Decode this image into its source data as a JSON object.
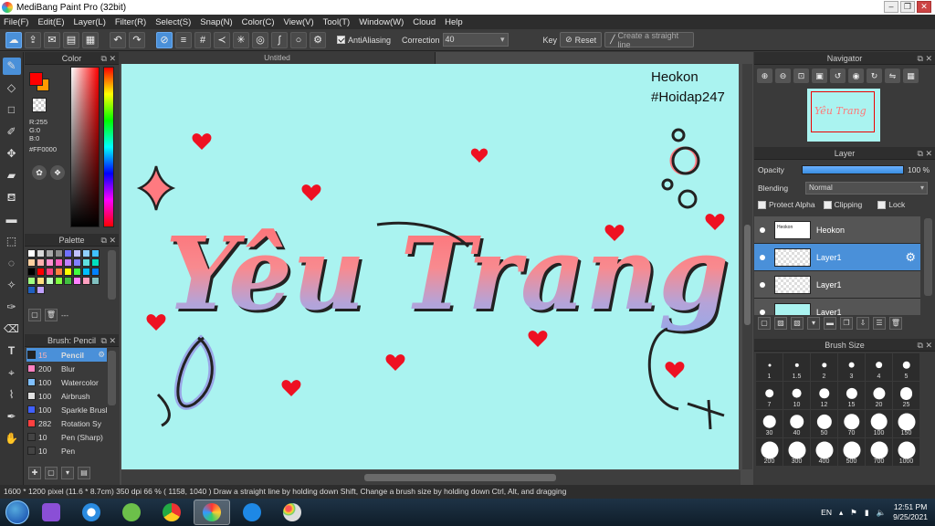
{
  "window": {
    "title": "MediBang Paint Pro (32bit)"
  },
  "menu": [
    "File(F)",
    "Edit(E)",
    "Layer(L)",
    "Filter(R)",
    "Select(S)",
    "Snap(N)",
    "Color(C)",
    "View(V)",
    "Tool(T)",
    "Window(W)",
    "Cloud",
    "Help"
  ],
  "toolbar": {
    "antialiasing_label": "AntiAliasing",
    "correction_label": "Correction",
    "correction_value": "40",
    "key_label": "Key",
    "reset_label": "Reset",
    "straight_line_placeholder": "Create a straight line"
  },
  "color_panel": {
    "title": "Color",
    "r": "R:255",
    "g": "G:0",
    "b": "B:0",
    "hex": "#FF0000",
    "fg_color": "#ff0000",
    "bg_color": "#ff9900"
  },
  "palette_panel": {
    "title": "Palette",
    "label": "---",
    "swatches": [
      "#ffffff",
      "#d8d8d8",
      "#a8a8a8",
      "#8c8c8c",
      "#7070ff",
      "#c0c0ff",
      "#90d0ff",
      "#40c0ff",
      "#ffd0a0",
      "#ffb0b0",
      "#ff90d0",
      "#ff60c0",
      "#c080ff",
      "#8080ff",
      "#60e0e0",
      "#00e0c0",
      "#000000",
      "#ff0000",
      "#ff4080",
      "#ff8040",
      "#ffff00",
      "#40ff40",
      "#00c0ff",
      "#0080ff",
      "#a0ff80",
      "#ffe080",
      "#c0ffc0",
      "#80ff40",
      "#40c040",
      "#ff80ff",
      "#ffa0c0",
      "#80c0c0",
      "#2060c0",
      "#c0a0ff"
    ]
  },
  "brush_panel": {
    "title": "Brush: Pencil",
    "brushes": [
      {
        "size": "15",
        "name": "Pencil",
        "color": "#222222",
        "selected": true
      },
      {
        "size": "200",
        "name": "Blur",
        "color": "#ff80c0",
        "selected": false
      },
      {
        "size": "100",
        "name": "Watercolor",
        "color": "#80c0ff",
        "selected": false
      },
      {
        "size": "100",
        "name": "Airbrush",
        "color": "#e0e0e0",
        "selected": false
      },
      {
        "size": "100",
        "name": "Sparkle Brush",
        "color": "#4060ff",
        "selected": false
      },
      {
        "size": "282",
        "name": "Rotation Sy",
        "color": "#ff4040",
        "selected": false
      },
      {
        "size": "10",
        "name": "Pen (Sharp)",
        "color": "#444444",
        "selected": false
      },
      {
        "size": "10",
        "name": "Pen",
        "color": "#444444",
        "selected": false
      }
    ]
  },
  "canvas": {
    "tab_label": "Untitled",
    "watermark_name": "Heokon",
    "watermark_tag": "#Hoidap247",
    "artwork_text": "Yêu Trang",
    "background": "#aaf3f0"
  },
  "navigator_panel": {
    "title": "Navigator"
  },
  "layer_panel": {
    "title": "Layer",
    "opacity_label": "Opacity",
    "opacity_value": "100 %",
    "opacity": 1.0,
    "blending_label": "Blending",
    "blending_value": "Normal",
    "protect_alpha_label": "Protect Alpha",
    "clipping_label": "Clipping",
    "lock_label": "Lock",
    "layers": [
      {
        "name": "Heokon",
        "selected": false,
        "thumb": "text"
      },
      {
        "name": "Layer1",
        "selected": true,
        "thumb": "checker"
      },
      {
        "name": "Layer1",
        "selected": false,
        "thumb": "checker"
      },
      {
        "name": "Layer1",
        "selected": false,
        "thumb": "cyan"
      }
    ]
  },
  "brush_size_panel": {
    "title": "Brush Size",
    "sizes": [
      "1",
      "1.5",
      "2",
      "3",
      "4",
      "5",
      "7",
      "10",
      "12",
      "15",
      "20",
      "25",
      "30",
      "40",
      "50",
      "70",
      "100",
      "150",
      "200",
      "300",
      "400",
      "500",
      "700",
      "1000"
    ]
  },
  "status": {
    "text": "1600 * 1200 pixel   (11.6 * 8.7cm)   350 dpi   66 %   ( 1158, 1040 )   Draw a straight line by holding down Shift, Change a brush size by holding down Ctrl, Alt, and dragging"
  },
  "taskbar": {
    "language": "EN",
    "time": "12:51 PM",
    "date": "9/25/2021"
  }
}
